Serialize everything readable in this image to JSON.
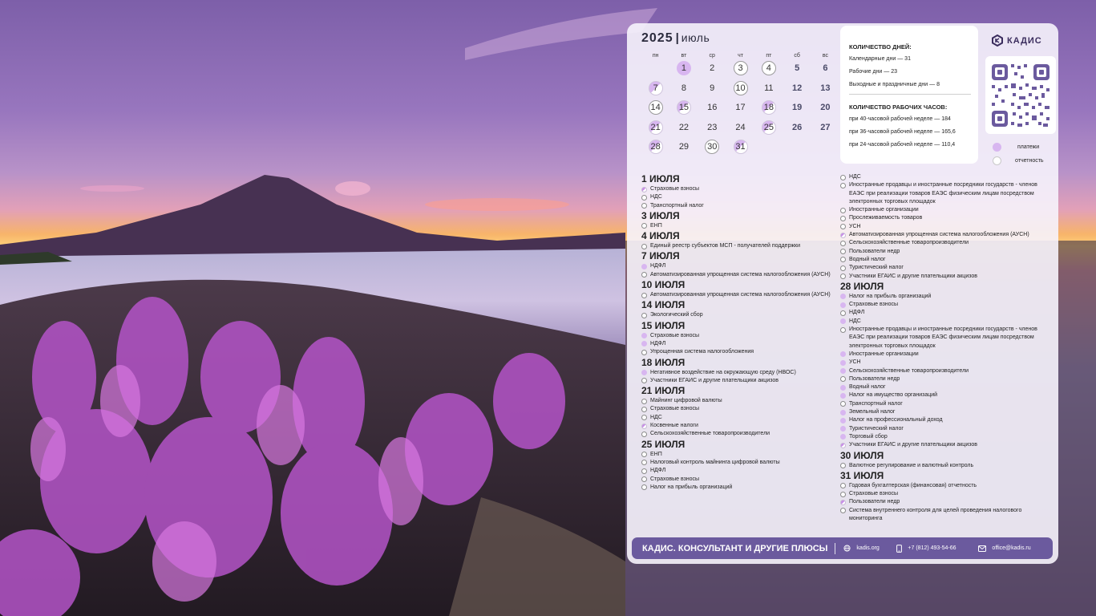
{
  "calendar": {
    "year": "2025",
    "separator": "|",
    "month": "июль",
    "weekdays": [
      "пн",
      "вт",
      "ср",
      "чт",
      "пт",
      "сб",
      "вс"
    ],
    "weeks": [
      [
        {
          "d": ""
        },
        {
          "d": "1",
          "m": "pay"
        },
        {
          "d": "2"
        },
        {
          "d": "3",
          "m": "rep"
        },
        {
          "d": "4",
          "m": "rep"
        },
        {
          "d": "5",
          "we": true
        },
        {
          "d": "6",
          "we": true
        }
      ],
      [
        {
          "d": "7",
          "m": "half"
        },
        {
          "d": "8"
        },
        {
          "d": "9"
        },
        {
          "d": "10",
          "m": "rep"
        },
        {
          "d": "11"
        },
        {
          "d": "12",
          "we": true
        },
        {
          "d": "13",
          "we": true
        }
      ],
      [
        {
          "d": "14",
          "m": "rep"
        },
        {
          "d": "15",
          "m": "half"
        },
        {
          "d": "16"
        },
        {
          "d": "17"
        },
        {
          "d": "18",
          "m": "half"
        },
        {
          "d": "19",
          "we": true
        },
        {
          "d": "20",
          "we": true
        }
      ],
      [
        {
          "d": "21",
          "m": "half"
        },
        {
          "d": "22"
        },
        {
          "d": "23"
        },
        {
          "d": "24"
        },
        {
          "d": "25",
          "m": "half"
        },
        {
          "d": "26",
          "we": true
        },
        {
          "d": "27",
          "we": true
        }
      ],
      [
        {
          "d": "28",
          "m": "half"
        },
        {
          "d": "29"
        },
        {
          "d": "30",
          "m": "rep"
        },
        {
          "d": "31",
          "m": "half"
        },
        {
          "d": ""
        },
        {
          "d": ""
        },
        {
          "d": ""
        }
      ]
    ]
  },
  "stats": {
    "days_title": "КОЛИЧЕСТВО ДНЕЙ:",
    "calendar_days": "Календарные дни — 31",
    "working_days": "Рабочие дни — 23",
    "weekend_days": "Выходные и праздничные дни — 8",
    "hours_title": "КОЛИЧЕСТВО РАБОЧИХ ЧАСОВ:",
    "hours_40": "при 40-часовой рабочей неделе — 184",
    "hours_36": "при 36-часовой рабочей неделе — 165,6",
    "hours_24": "при 24-часовой рабочей неделе — 110,4"
  },
  "brand": {
    "name": "КАДИС"
  },
  "legend": {
    "payments": "платежи",
    "reports": "отчетность"
  },
  "events_left": [
    {
      "date": "1 ИЮЛЯ",
      "items": [
        {
          "t": "Страховые взносы",
          "m": "h"
        },
        {
          "t": "НДС",
          "m": "r"
        },
        {
          "t": "Транспортный налог",
          "m": "r"
        }
      ]
    },
    {
      "date": "3 ИЮЛЯ",
      "items": [
        {
          "t": "ЕНП",
          "m": "r"
        }
      ]
    },
    {
      "date": "4 ИЮЛЯ",
      "items": [
        {
          "t": "Единый реестр субъектов МСП - получателей поддержки",
          "m": "r"
        }
      ]
    },
    {
      "date": "7 ИЮЛЯ",
      "items": [
        {
          "t": "НДФЛ",
          "m": "p"
        },
        {
          "t": "Автоматизированная упрощенная система налогообложения (АУСН)",
          "m": "r"
        }
      ]
    },
    {
      "date": "10 ИЮЛЯ",
      "items": [
        {
          "t": "Автоматизированная упрощенная система налогообложения (АУСН)",
          "m": "r"
        }
      ]
    },
    {
      "date": "14 ИЮЛЯ",
      "items": [
        {
          "t": "Экологический сбор",
          "m": "r"
        }
      ]
    },
    {
      "date": "15 ИЮЛЯ",
      "items": [
        {
          "t": "Страховые взносы",
          "m": "p"
        },
        {
          "t": "НДФЛ",
          "m": "p"
        },
        {
          "t": "Упрощенная система налогообложения",
          "m": "r"
        }
      ]
    },
    {
      "date": "18 ИЮЛЯ",
      "items": [
        {
          "t": "Негативное воздействие на окружающую среду (НВОС)",
          "m": "p"
        },
        {
          "t": "Участники ЕГАИС и другие плательщики акцизов",
          "m": "r"
        }
      ]
    },
    {
      "date": "21 ИЮЛЯ",
      "items": [
        {
          "t": "Майнинг цифровой валюты",
          "m": "r"
        },
        {
          "t": "Страховые взносы",
          "m": "r"
        },
        {
          "t": "НДС",
          "m": "r"
        },
        {
          "t": "Косвенные налоги",
          "m": "h"
        },
        {
          "t": "Сельскохозяйственные товаропроизводители",
          "m": "r"
        }
      ]
    },
    {
      "date": "25 ИЮЛЯ",
      "items": [
        {
          "t": "ЕНП",
          "m": "r"
        },
        {
          "t": "Налоговый контроль майнинга цифровой валюты",
          "m": "r"
        },
        {
          "t": "НДФЛ",
          "m": "r"
        },
        {
          "t": "Страховые взносы",
          "m": "r"
        },
        {
          "t": "Налог на прибыль организаций",
          "m": "r"
        }
      ]
    }
  ],
  "events_right": [
    {
      "date": "",
      "items": [
        {
          "t": "НДС",
          "m": "r"
        },
        {
          "t": "Иностранные продавцы и иностранные посредники государств - членов ЕАЭС при реализации товаров ЕАЭС физическим лицам посредством электронных торговых площадок",
          "m": "r"
        },
        {
          "t": "Иностранные организации",
          "m": "r"
        },
        {
          "t": "Прослеживаемость товаров",
          "m": "r"
        },
        {
          "t": "УСН",
          "m": "r"
        },
        {
          "t": "Автоматизированная упрощенная система налогообложения (АУСН)",
          "m": "h"
        },
        {
          "t": "Сельскохозяйственные товаропроизводители",
          "m": "r"
        },
        {
          "t": "Пользователи недр",
          "m": "r"
        },
        {
          "t": "Водный налог",
          "m": "r"
        },
        {
          "t": "Туристический налог",
          "m": "r"
        },
        {
          "t": "Участники ЕГАИС и другие плательщики акцизов",
          "m": "r"
        }
      ]
    },
    {
      "date": "28 ИЮЛЯ",
      "items": [
        {
          "t": "Налог на прибыль организаций",
          "m": "p"
        },
        {
          "t": "Страховые взносы",
          "m": "p"
        },
        {
          "t": "НДФЛ",
          "m": "r"
        },
        {
          "t": "НДС",
          "m": "p"
        },
        {
          "t": "Иностранные продавцы и иностранные посредники государств - членов ЕАЭС при реализации товаров ЕАЭС физическим лицам посредством электронных торговых площадок",
          "m": "r"
        },
        {
          "t": "Иностранные организации",
          "m": "p"
        },
        {
          "t": "УСН",
          "m": "p"
        },
        {
          "t": "Сельскохозяйственные товаропроизводители",
          "m": "p"
        },
        {
          "t": "Пользователи недр",
          "m": "r"
        },
        {
          "t": "Водный налог",
          "m": "p"
        },
        {
          "t": "Налог на имущество организаций",
          "m": "p"
        },
        {
          "t": "Транспортный налог",
          "m": "r"
        },
        {
          "t": "Земельный налог",
          "m": "p"
        },
        {
          "t": "Налог на профессиональный доход",
          "m": "p"
        },
        {
          "t": "Туристический налог",
          "m": "p"
        },
        {
          "t": "Торговый сбор",
          "m": "p"
        },
        {
          "t": "Участники ЕГАИС и другие плательщики акцизов",
          "m": "h"
        }
      ]
    },
    {
      "date": "30 ИЮЛЯ",
      "items": [
        {
          "t": "Валютное регулирование и валютный контроль",
          "m": "r"
        }
      ]
    },
    {
      "date": "31 ИЮЛЯ",
      "items": [
        {
          "t": "Годовая бухгалтерская (финансовая) отчетность",
          "m": "r"
        },
        {
          "t": "Страховые взносы",
          "m": "r"
        },
        {
          "t": "Пользователи недр",
          "m": "h"
        },
        {
          "t": "Система внутреннего контроля для целей проведения налогового мониторинга",
          "m": "r"
        }
      ]
    }
  ],
  "footer": {
    "title": "КАДИС. КОНСУЛЬТАНТ И ДРУГИЕ ПЛЮСЫ",
    "website": "kadis.org",
    "phone": "+7 (812) 493-54-66",
    "email": "office@kadis.ru"
  },
  "colors": {
    "accent": "#6b5a9e",
    "payment_mark": "#d8b6f0",
    "panel": "#f6f3fc"
  },
  "icons": [
    "globe-icon",
    "phone-icon",
    "mail-icon",
    "kadis-logo-icon",
    "qr-code"
  ]
}
